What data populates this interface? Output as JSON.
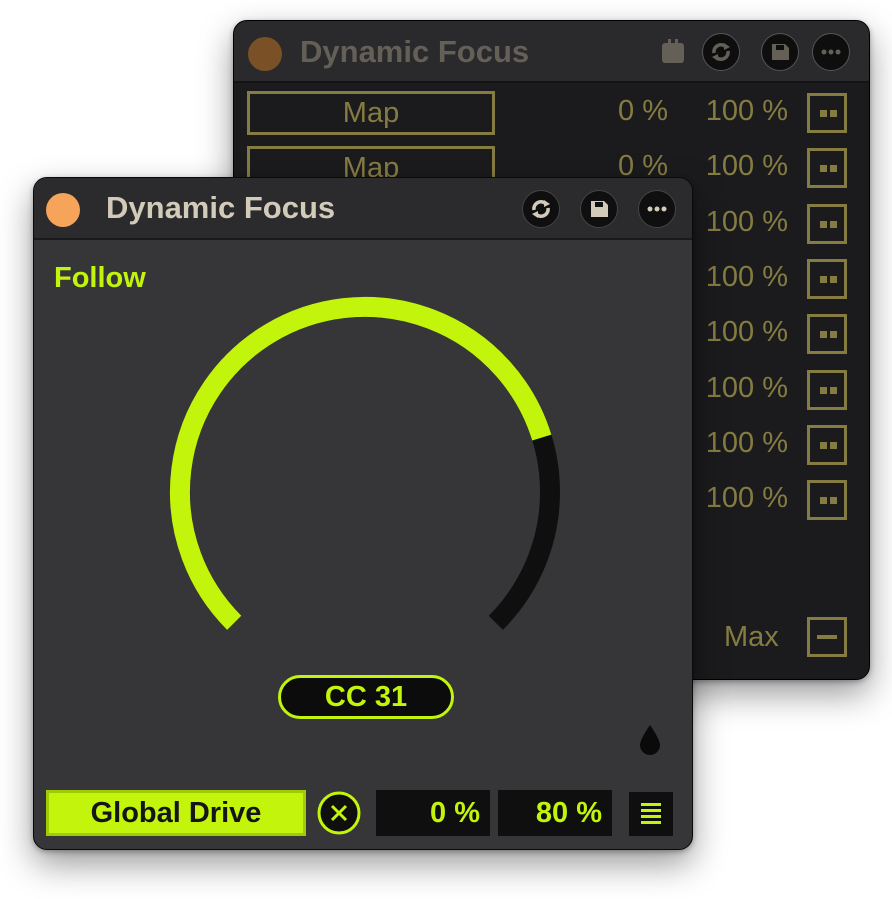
{
  "back_device": {
    "title": "Dynamic Focus",
    "dot_color": "#7a5127",
    "text_color": "#857c42",
    "header_icons": [
      "pin-icon",
      "refresh-icon",
      "save-icon",
      "more-icon"
    ],
    "rows": [
      {
        "map_label": "Map",
        "min": "0 %",
        "max": "100 %"
      },
      {
        "map_label": "Map",
        "min": "0 %",
        "max": "100 %"
      },
      {
        "map_label": "",
        "min": "",
        "max": "100 %"
      },
      {
        "map_label": "",
        "min": "",
        "max": "100 %"
      },
      {
        "map_label": "",
        "min": "",
        "max": "100 %"
      },
      {
        "map_label": "",
        "min": "",
        "max": "100 %"
      },
      {
        "map_label": "",
        "min": "",
        "max": "100 %"
      },
      {
        "map_label": "",
        "min": "",
        "max": "100 %"
      }
    ],
    "footer_label": "Max"
  },
  "front_device": {
    "title": "Dynamic Focus",
    "dot_color": "#f5a45a",
    "accent_color": "#c2f50b",
    "header_icons": [
      "refresh-icon",
      "save-icon",
      "more-icon"
    ],
    "mode_label": "Follow",
    "dial": {
      "value_fraction": 0.77,
      "cc_label": "CC 31"
    },
    "global_drive_label": "Global Drive",
    "min_value": "0 %",
    "max_value": "80 %"
  }
}
